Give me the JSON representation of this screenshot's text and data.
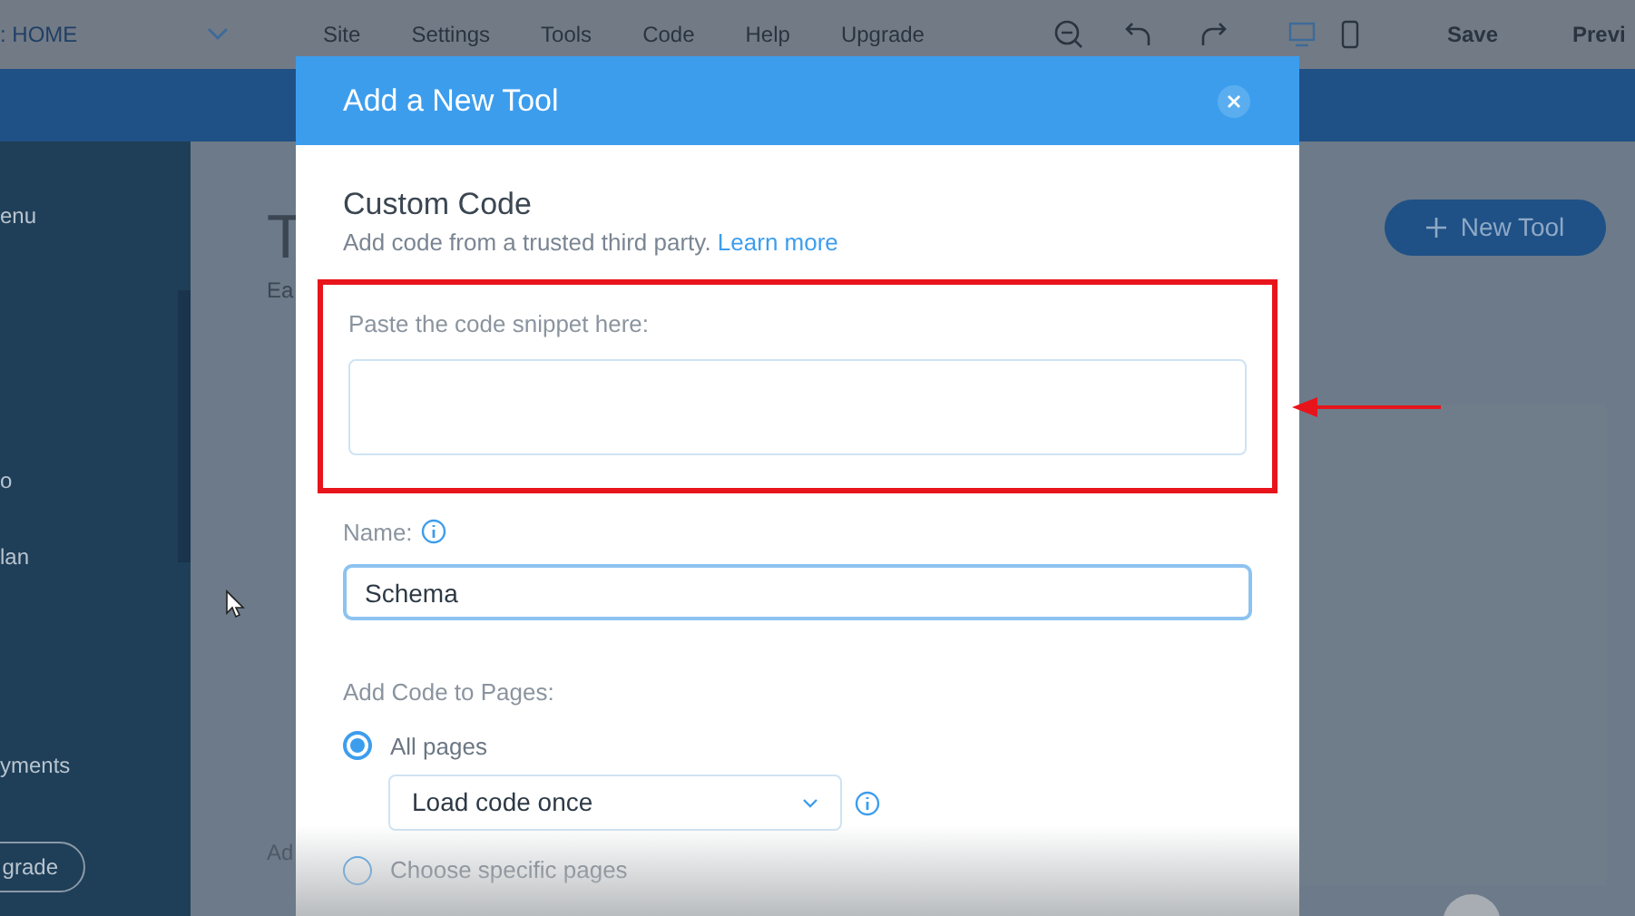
{
  "top_bar": {
    "page_label": ": HOME",
    "menu": [
      "Site",
      "Settings",
      "Tools",
      "Code",
      "Help",
      "Upgrade"
    ],
    "save": "Save",
    "preview": "Previ"
  },
  "sidebar": {
    "items": [
      "enu",
      "o",
      "lan",
      "yments"
    ],
    "upgrade_button": "grade"
  },
  "main": {
    "title": "T",
    "subtitle": "Ea",
    "footer_text": "Ad",
    "new_tool_button": "New Tool"
  },
  "dialog": {
    "title": "Add a New Tool",
    "heading": "Custom Code",
    "description": "Add code from a trusted third party.",
    "learn_more": "Learn more",
    "snippet": {
      "label": "Paste the code snippet here:",
      "highlighted": true
    },
    "name": {
      "label": "Name:",
      "value": "Schema"
    },
    "pages": {
      "label": "Add Code to Pages:",
      "options": [
        {
          "label": "All pages",
          "selected": true
        },
        {
          "label": "Choose specific pages",
          "selected": false
        }
      ],
      "load_select": "Load code once"
    }
  }
}
